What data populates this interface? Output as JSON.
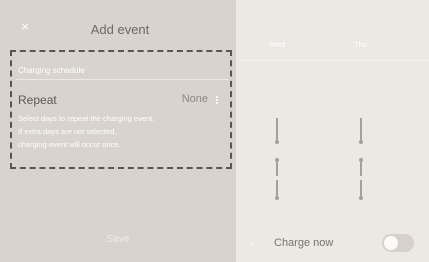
{
  "header": {
    "close_glyph": "×",
    "title": "Add event"
  },
  "charging": {
    "section_label": "Charging schedule",
    "repeat_label": "Repeat",
    "repeat_value": "None",
    "description_lines": [
      "Select days to repeat the charging event.",
      "If extra days are not selected,",
      "charging event will occur once."
    ]
  },
  "footer": {
    "save_label": "Save"
  },
  "calendar": {
    "days": [
      "Wed",
      "Thu"
    ]
  },
  "bottom": {
    "chevron_glyph": "‹",
    "charge_now_label": "Charge now",
    "charge_now_on": false
  },
  "icons": {
    "close": "close-icon",
    "more": "more-vertical-icon",
    "chevron": "chevron-left-icon"
  },
  "colors": {
    "left_panel": "#d8d3cd",
    "right_panel": "#ece9e5",
    "highlight_border": "#5a5550"
  }
}
